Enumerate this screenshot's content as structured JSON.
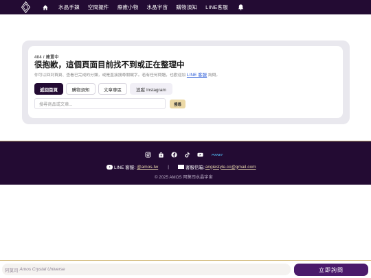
{
  "nav": {
    "logo": "diamond-logo-icon",
    "items": [
      "水晶手鍊",
      "空間擺件",
      "療癒小物",
      "水晶宇宙",
      "購物須知",
      "LINE客服"
    ]
  },
  "error": {
    "eyebrow": "404 / 建置中",
    "title": "很抱歉，這個頁面目前找不到或正在整理中",
    "desc_before": "你可以回到首頁、查看已完成的分類，或是直接搜尋關鍵字。若有任何問題，也歡迎加",
    "desc_link": "LINE 客服",
    "desc_after": "詢問。",
    "buttons": {
      "home": "返回首頁",
      "guide": "購物須知",
      "blog": "文章專區",
      "instagram": "追蹤 Instagram"
    },
    "search_placeholder": "搜尋商品或文章...",
    "search_button": "搜尋"
  },
  "footer": {
    "social": [
      "instagram-icon",
      "shopping-bag-icon",
      "facebook-icon",
      "tiktok-icon",
      "youtube-icon",
      "pixnet-icon"
    ],
    "pixnet_text": "PIXNET",
    "line_label": "LINE 客服:",
    "line_id": "@amos-tw",
    "separator": "|",
    "mail_label": "客服信箱:",
    "mail": "angiestyle.cc@gmail.com",
    "copyright": "© 2025 AMOS 阿莫司水晶宇宙"
  },
  "bottom": {
    "placeholder": "阿莫司",
    "placeholder_em": "Amos Crystal Universe",
    "cta": "立即詢問"
  },
  "colors": {
    "brand_dark": "#230b33",
    "accent_gold": "#ecd9a6",
    "cta_purple": "#4b1a6b"
  }
}
